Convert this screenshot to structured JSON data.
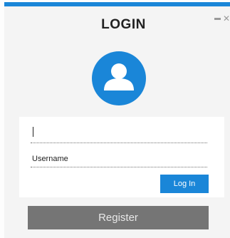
{
  "dialog": {
    "title": "LOGIN"
  },
  "window_controls": {
    "minimize_icon": "minimize-icon",
    "close_icon": "close-icon",
    "close_glyph": "✕"
  },
  "avatar": {
    "icon": "user-icon"
  },
  "form": {
    "first_field_value": "",
    "username_placeholder": "Username",
    "login_label": "Log In"
  },
  "register": {
    "label": "Register"
  },
  "colors": {
    "accent": "#1a86d8",
    "register_bg": "#757575",
    "panel_bg": "#f4f4f4",
    "card_bg": "#ffffff",
    "text": "#222222"
  }
}
